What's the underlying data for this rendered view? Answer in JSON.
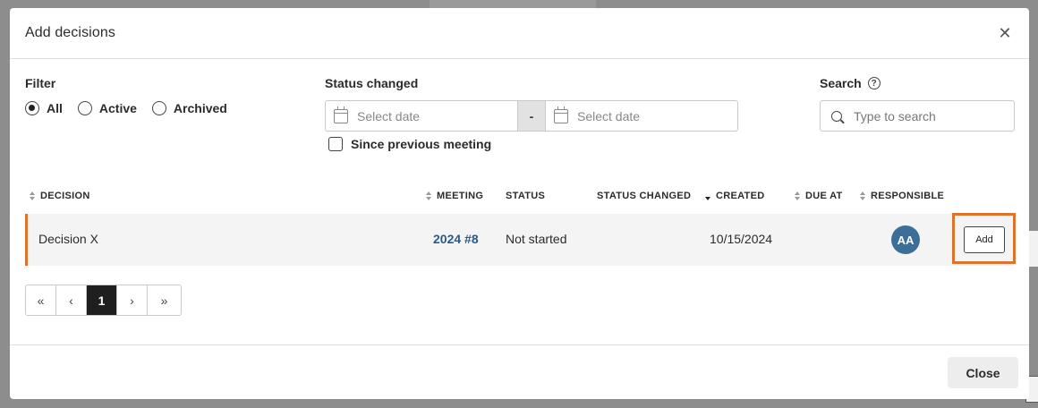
{
  "modal": {
    "title": "Add decisions",
    "close_icon": "close-icon"
  },
  "filter": {
    "label": "Filter",
    "options": [
      {
        "label": "All",
        "checked": true
      },
      {
        "label": "Active",
        "checked": false
      },
      {
        "label": "Archived",
        "checked": false
      }
    ]
  },
  "status_changed": {
    "label": "Status changed",
    "from_placeholder": "Select date",
    "separator": "-",
    "to_placeholder": "Select date",
    "since_previous_label": "Since previous meeting",
    "since_previous_checked": false
  },
  "search": {
    "label": "Search",
    "help_glyph": "?",
    "placeholder": "Type to search",
    "value": ""
  },
  "table": {
    "columns": [
      {
        "key": "decision",
        "label": "DECISION",
        "sortable": true,
        "sort": "none"
      },
      {
        "key": "meeting",
        "label": "MEETING",
        "sortable": true,
        "sort": "none"
      },
      {
        "key": "status",
        "label": "STATUS",
        "sortable": false
      },
      {
        "key": "status_changed",
        "label": "STATUS CHANGED",
        "sortable": false
      },
      {
        "key": "created",
        "label": "CREATED",
        "sortable": true,
        "sort": "desc"
      },
      {
        "key": "due_at",
        "label": "DUE AT",
        "sortable": true,
        "sort": "none"
      },
      {
        "key": "responsible",
        "label": "RESPONSIBLE",
        "sortable": true,
        "sort": "none"
      }
    ],
    "rows": [
      {
        "decision": "Decision X",
        "meeting": "2024 #8",
        "status": "Not started",
        "status_changed": "",
        "created": "10/15/2024",
        "due_at": "",
        "responsible_initials": "AA",
        "action_label": "Add"
      }
    ]
  },
  "pagination": {
    "first": "«",
    "prev": "‹",
    "current": "1",
    "next": "›",
    "last": "»"
  },
  "footer": {
    "close_label": "Close"
  },
  "colors": {
    "accent": "#e0722f",
    "link": "#2a5a8a",
    "avatar": "#3b6e99"
  }
}
